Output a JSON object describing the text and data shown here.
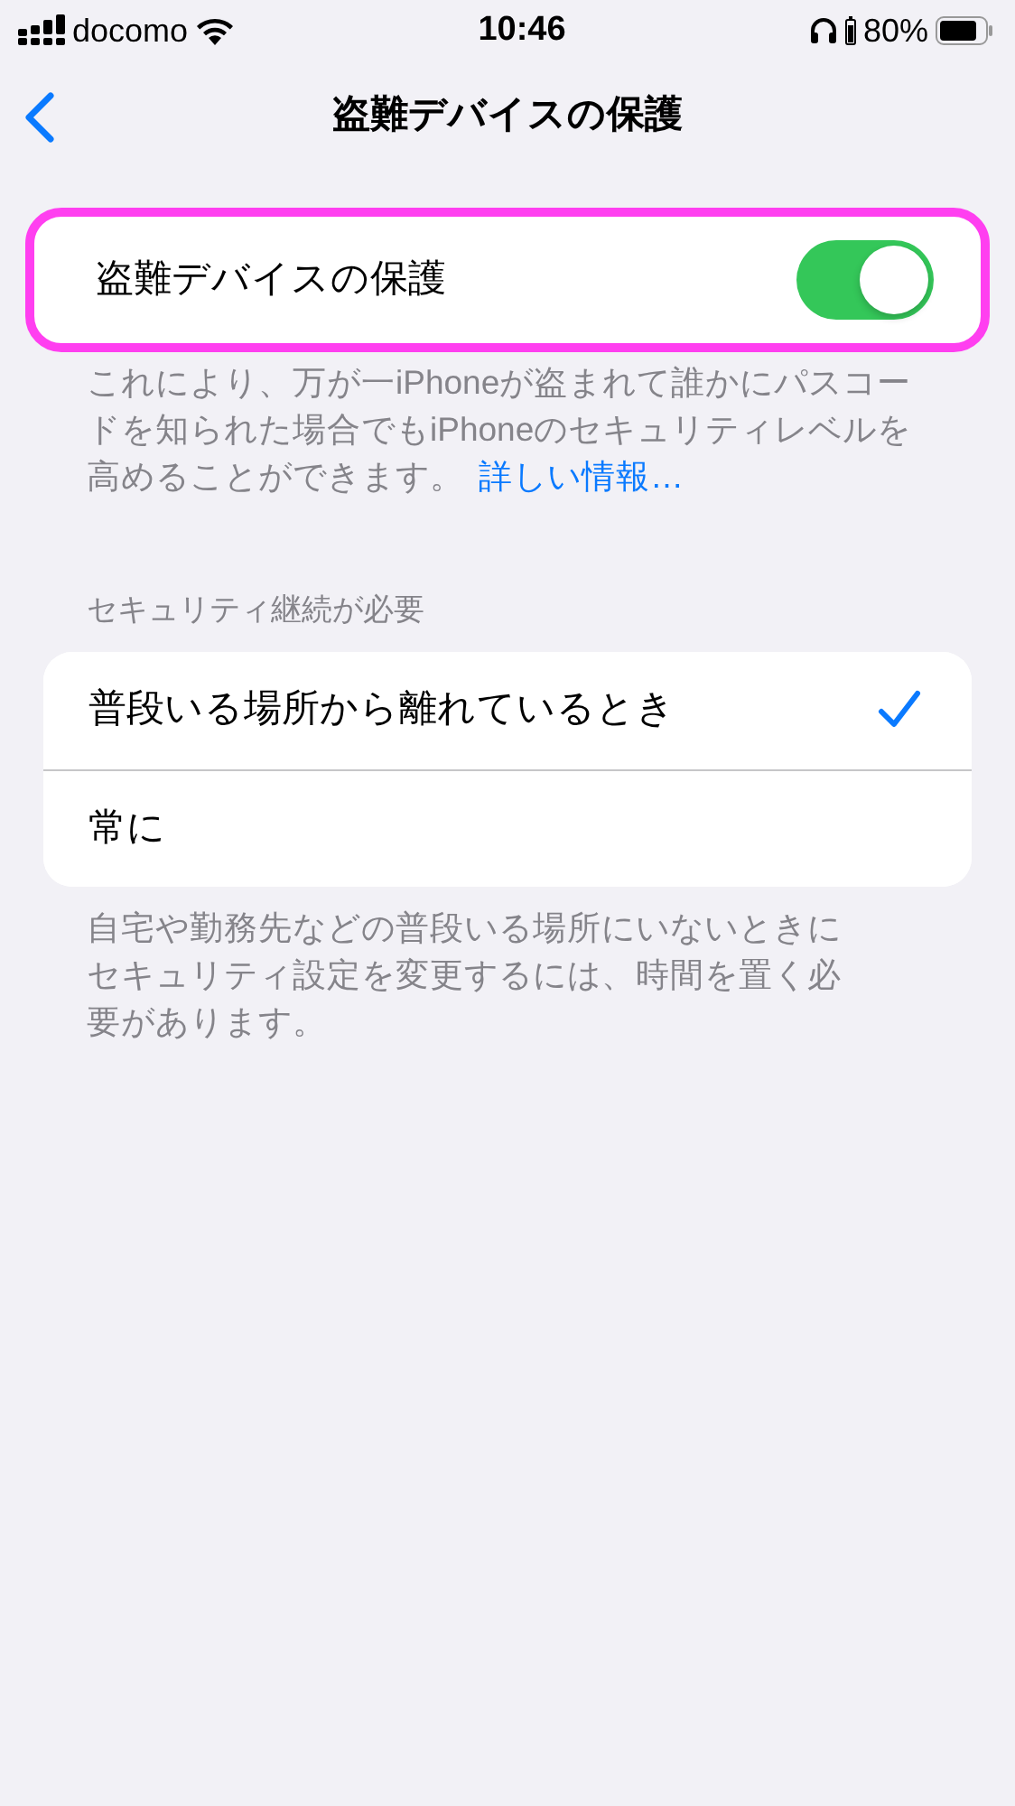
{
  "status_bar": {
    "carrier": "docomo",
    "time": "10:46",
    "battery": "80%"
  },
  "nav": {
    "title": "盗難デバイスの保護"
  },
  "toggle_card": {
    "label": "盗難デバイスの保護",
    "on": true,
    "highlighted": true
  },
  "toggle_footer": {
    "text": "これにより、万が一iPhoneが盗まれて誰かにパスコードを知られた場合でもiPhoneのセキュリティレベルを高めることができます。",
    "link": "詳しい情報…"
  },
  "section": {
    "header": "セキュリティ継続が必要",
    "options": [
      {
        "label": "普段いる場所から離れているとき",
        "selected": true
      },
      {
        "label": "常に",
        "selected": false
      }
    ],
    "footer": "自宅や勤務先などの普段いる場所にいないときにセキュリティ設定を変更するには、時間を置く必要があります。"
  }
}
